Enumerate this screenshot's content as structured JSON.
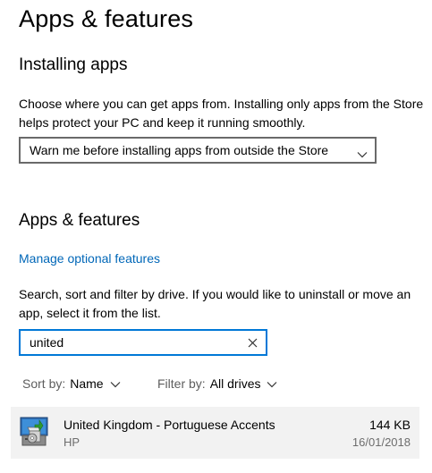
{
  "page": {
    "title": "Apps & features"
  },
  "installing_apps": {
    "heading": "Installing apps",
    "description": "Choose where you can get apps from. Installing only apps from the Store helps protect your PC and keep it running smoothly.",
    "dropdown_value": "Warn me before installing apps from outside the Store"
  },
  "apps_features": {
    "heading": "Apps & features",
    "manage_link": "Manage optional features",
    "search_description": "Search, sort and filter by drive. If you would like to uninstall or move an app, select it from the list.",
    "search_value": "united",
    "sort_label": "Sort by:",
    "sort_value": "Name",
    "filter_label": "Filter by:",
    "filter_value": "All drives"
  },
  "apps": [
    {
      "name": "United Kingdom - Portuguese Accents",
      "publisher": "HP",
      "size": "144 KB",
      "date": "16/01/2018",
      "icon": "installer-package-icon"
    }
  ],
  "colors": {
    "link": "#0067b8",
    "search_border": "#0078d7",
    "list_item_bg": "#f2f2f2"
  }
}
